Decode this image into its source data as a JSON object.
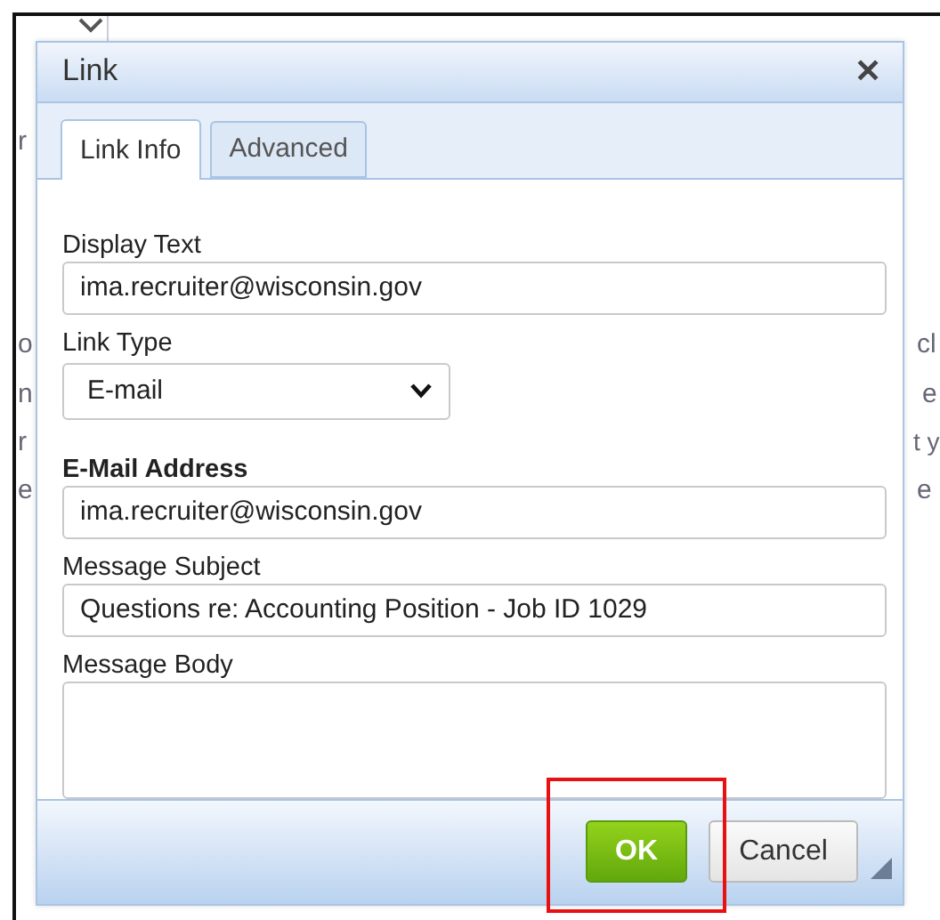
{
  "background": {
    "left_fragments": [
      "r",
      "o",
      "n",
      "r",
      "e"
    ],
    "right_fragments": [
      "cl",
      "e",
      "t y",
      "e"
    ]
  },
  "dialog": {
    "title": "Link",
    "close": "✕",
    "tabs": [
      {
        "label": "Link Info",
        "selected": true
      },
      {
        "label": "Advanced",
        "selected": false
      }
    ],
    "fields": [
      {
        "kind": "input",
        "label": "Display Text",
        "bold": false,
        "value": "ima.recruiter@wisconsin.gov"
      },
      {
        "kind": "select",
        "label": "Link Type",
        "bold": false,
        "value": "E-mail"
      },
      {
        "kind": "input",
        "label": "E-Mail Address",
        "bold": true,
        "value": "ima.recruiter@wisconsin.gov"
      },
      {
        "kind": "input",
        "label": "Message Subject",
        "bold": false,
        "value": "Questions re: Accounting Position - Job ID 1029"
      },
      {
        "kind": "textarea",
        "label": "Message Body",
        "bold": false
      }
    ],
    "buttons": [
      {
        "label": "OK",
        "kind": "primary",
        "highlighted": true
      },
      {
        "label": "Cancel",
        "kind": "secondary",
        "highlighted": false
      }
    ]
  }
}
